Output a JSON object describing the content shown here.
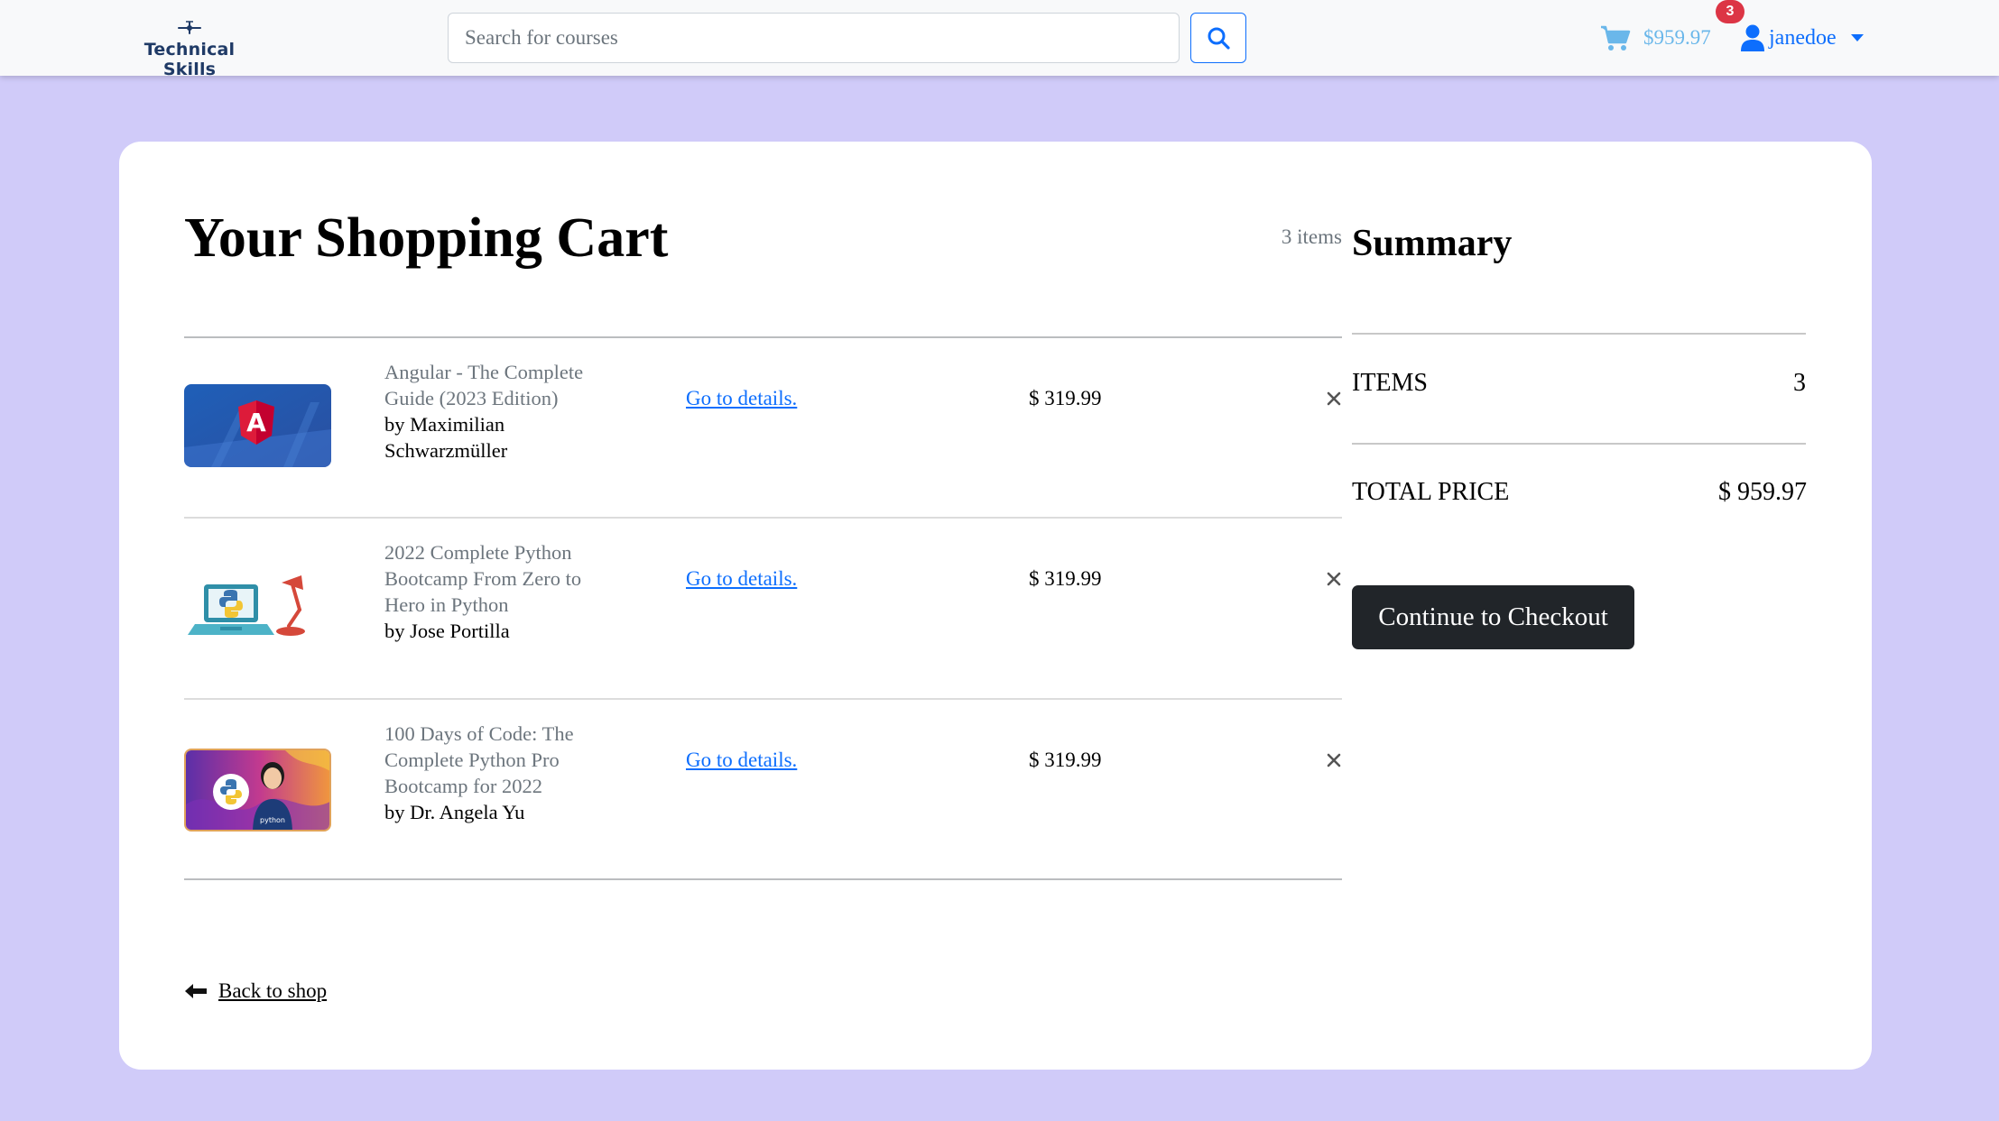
{
  "navbar": {
    "brand_name": "Technical Skills",
    "search_placeholder": "Search for courses",
    "cart_total": "$959.97",
    "cart_badge": "3",
    "username": "janedoe"
  },
  "cart": {
    "title": "Your Shopping Cart",
    "item_count": "3 items",
    "details_label": "Go to details.",
    "items": [
      {
        "title": "Angular - The Complete Guide (2023 Edition)",
        "author": "by Maximilian Schwarzmüller",
        "price": "$ 319.99",
        "thumbnail_icon": "angular-logo-icon"
      },
      {
        "title": "2022 Complete Python Bootcamp From Zero to Hero in Python",
        "author": "by Jose Portilla",
        "price": "$ 319.99",
        "thumbnail_icon": "python-laptop-icon"
      },
      {
        "title": "100 Days of Code: The Complete Python Pro Bootcamp for 2022",
        "author": "by Dr. Angela Yu",
        "price": "$ 319.99",
        "thumbnail_icon": "python-instructor-icon"
      }
    ],
    "back_label": "Back to shop"
  },
  "summary": {
    "title": "Summary",
    "items_label": "ITEMS",
    "items_value": "3",
    "total_label": "TOTAL PRICE",
    "total_value": "$ 959.97",
    "checkout_label": "Continue to Checkout",
    "thumb_badge_text": "python"
  },
  "colors": {
    "page_background": "#d0cbf9",
    "navbar_background": "#f8f9fa",
    "link_blue": "#0d6efd",
    "cart_light_blue": "#6ab7ea",
    "badge_red": "#dc3545",
    "checkout_dark": "#212529",
    "brand_navy": "#1f3a66"
  }
}
